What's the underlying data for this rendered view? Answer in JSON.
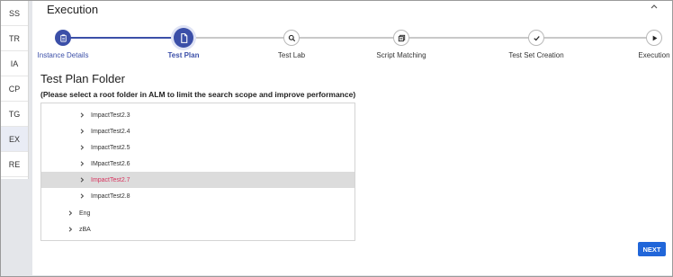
{
  "sidebar": {
    "items": [
      {
        "label": "SS",
        "active": false
      },
      {
        "label": "TR",
        "active": false
      },
      {
        "label": "IA",
        "active": false
      },
      {
        "label": "CP",
        "active": false
      },
      {
        "label": "TG",
        "active": false
      },
      {
        "label": "EX",
        "active": true
      },
      {
        "label": "RE",
        "active": false
      }
    ]
  },
  "header": {
    "title": "Execution",
    "collapse_icon": "chevron-up-icon"
  },
  "stepper": {
    "steps": [
      {
        "label": "Instance Details",
        "state": "done",
        "icon": "clipboard-icon"
      },
      {
        "label": "Test Plan",
        "state": "current",
        "icon": "document-icon"
      },
      {
        "label": "Test Lab",
        "state": "todo",
        "icon": "search-icon"
      },
      {
        "label": "Script Matching",
        "state": "todo",
        "icon": "copy-icon"
      },
      {
        "label": "Test Set Creation",
        "state": "todo",
        "icon": "check-icon"
      },
      {
        "label": "Execution",
        "state": "todo",
        "icon": "play-icon"
      }
    ]
  },
  "main": {
    "title": "Test Plan Folder",
    "subtitle": "(Please select a root folder in ALM to limit the search scope and improve performance)"
  },
  "tree": {
    "items": [
      {
        "label": "ImpactTest2.3",
        "level": 2,
        "selected": false
      },
      {
        "label": "ImpactTest2.4",
        "level": 2,
        "selected": false
      },
      {
        "label": "ImpactTest2.5",
        "level": 2,
        "selected": false
      },
      {
        "label": "IMpactTest2.6",
        "level": 2,
        "selected": false
      },
      {
        "label": "ImpactTest2.7",
        "level": 2,
        "selected": true
      },
      {
        "label": "ImpactTest2.8",
        "level": 2,
        "selected": false
      },
      {
        "label": "Eng",
        "level": 1,
        "selected": false
      },
      {
        "label": "zBA",
        "level": 1,
        "selected": false
      }
    ]
  },
  "footer": {
    "next_label": "NEXT"
  },
  "colors": {
    "primary": "#3b4fa8",
    "button": "#2166d9",
    "selected_text": "#d8345f",
    "selected_row": "#dcdcdc"
  }
}
